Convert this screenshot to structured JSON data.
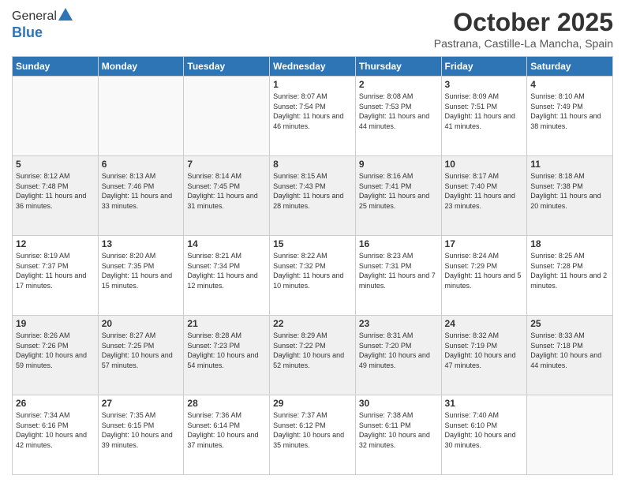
{
  "logo": {
    "general": "General",
    "blue": "Blue"
  },
  "title": "October 2025",
  "location": "Pastrana, Castille-La Mancha, Spain",
  "days_of_week": [
    "Sunday",
    "Monday",
    "Tuesday",
    "Wednesday",
    "Thursday",
    "Friday",
    "Saturday"
  ],
  "weeks": [
    [
      {
        "day": "",
        "sunrise": "",
        "sunset": "",
        "daylight": ""
      },
      {
        "day": "",
        "sunrise": "",
        "sunset": "",
        "daylight": ""
      },
      {
        "day": "",
        "sunrise": "",
        "sunset": "",
        "daylight": ""
      },
      {
        "day": "1",
        "sunrise": "Sunrise: 8:07 AM",
        "sunset": "Sunset: 7:54 PM",
        "daylight": "Daylight: 11 hours and 46 minutes."
      },
      {
        "day": "2",
        "sunrise": "Sunrise: 8:08 AM",
        "sunset": "Sunset: 7:53 PM",
        "daylight": "Daylight: 11 hours and 44 minutes."
      },
      {
        "day": "3",
        "sunrise": "Sunrise: 8:09 AM",
        "sunset": "Sunset: 7:51 PM",
        "daylight": "Daylight: 11 hours and 41 minutes."
      },
      {
        "day": "4",
        "sunrise": "Sunrise: 8:10 AM",
        "sunset": "Sunset: 7:49 PM",
        "daylight": "Daylight: 11 hours and 38 minutes."
      }
    ],
    [
      {
        "day": "5",
        "sunrise": "Sunrise: 8:12 AM",
        "sunset": "Sunset: 7:48 PM",
        "daylight": "Daylight: 11 hours and 36 minutes."
      },
      {
        "day": "6",
        "sunrise": "Sunrise: 8:13 AM",
        "sunset": "Sunset: 7:46 PM",
        "daylight": "Daylight: 11 hours and 33 minutes."
      },
      {
        "day": "7",
        "sunrise": "Sunrise: 8:14 AM",
        "sunset": "Sunset: 7:45 PM",
        "daylight": "Daylight: 11 hours and 31 minutes."
      },
      {
        "day": "8",
        "sunrise": "Sunrise: 8:15 AM",
        "sunset": "Sunset: 7:43 PM",
        "daylight": "Daylight: 11 hours and 28 minutes."
      },
      {
        "day": "9",
        "sunrise": "Sunrise: 8:16 AM",
        "sunset": "Sunset: 7:41 PM",
        "daylight": "Daylight: 11 hours and 25 minutes."
      },
      {
        "day": "10",
        "sunrise": "Sunrise: 8:17 AM",
        "sunset": "Sunset: 7:40 PM",
        "daylight": "Daylight: 11 hours and 23 minutes."
      },
      {
        "day": "11",
        "sunrise": "Sunrise: 8:18 AM",
        "sunset": "Sunset: 7:38 PM",
        "daylight": "Daylight: 11 hours and 20 minutes."
      }
    ],
    [
      {
        "day": "12",
        "sunrise": "Sunrise: 8:19 AM",
        "sunset": "Sunset: 7:37 PM",
        "daylight": "Daylight: 11 hours and 17 minutes."
      },
      {
        "day": "13",
        "sunrise": "Sunrise: 8:20 AM",
        "sunset": "Sunset: 7:35 PM",
        "daylight": "Daylight: 11 hours and 15 minutes."
      },
      {
        "day": "14",
        "sunrise": "Sunrise: 8:21 AM",
        "sunset": "Sunset: 7:34 PM",
        "daylight": "Daylight: 11 hours and 12 minutes."
      },
      {
        "day": "15",
        "sunrise": "Sunrise: 8:22 AM",
        "sunset": "Sunset: 7:32 PM",
        "daylight": "Daylight: 11 hours and 10 minutes."
      },
      {
        "day": "16",
        "sunrise": "Sunrise: 8:23 AM",
        "sunset": "Sunset: 7:31 PM",
        "daylight": "Daylight: 11 hours and 7 minutes."
      },
      {
        "day": "17",
        "sunrise": "Sunrise: 8:24 AM",
        "sunset": "Sunset: 7:29 PM",
        "daylight": "Daylight: 11 hours and 5 minutes."
      },
      {
        "day": "18",
        "sunrise": "Sunrise: 8:25 AM",
        "sunset": "Sunset: 7:28 PM",
        "daylight": "Daylight: 11 hours and 2 minutes."
      }
    ],
    [
      {
        "day": "19",
        "sunrise": "Sunrise: 8:26 AM",
        "sunset": "Sunset: 7:26 PM",
        "daylight": "Daylight: 10 hours and 59 minutes."
      },
      {
        "day": "20",
        "sunrise": "Sunrise: 8:27 AM",
        "sunset": "Sunset: 7:25 PM",
        "daylight": "Daylight: 10 hours and 57 minutes."
      },
      {
        "day": "21",
        "sunrise": "Sunrise: 8:28 AM",
        "sunset": "Sunset: 7:23 PM",
        "daylight": "Daylight: 10 hours and 54 minutes."
      },
      {
        "day": "22",
        "sunrise": "Sunrise: 8:29 AM",
        "sunset": "Sunset: 7:22 PM",
        "daylight": "Daylight: 10 hours and 52 minutes."
      },
      {
        "day": "23",
        "sunrise": "Sunrise: 8:31 AM",
        "sunset": "Sunset: 7:20 PM",
        "daylight": "Daylight: 10 hours and 49 minutes."
      },
      {
        "day": "24",
        "sunrise": "Sunrise: 8:32 AM",
        "sunset": "Sunset: 7:19 PM",
        "daylight": "Daylight: 10 hours and 47 minutes."
      },
      {
        "day": "25",
        "sunrise": "Sunrise: 8:33 AM",
        "sunset": "Sunset: 7:18 PM",
        "daylight": "Daylight: 10 hours and 44 minutes."
      }
    ],
    [
      {
        "day": "26",
        "sunrise": "Sunrise: 7:34 AM",
        "sunset": "Sunset: 6:16 PM",
        "daylight": "Daylight: 10 hours and 42 minutes."
      },
      {
        "day": "27",
        "sunrise": "Sunrise: 7:35 AM",
        "sunset": "Sunset: 6:15 PM",
        "daylight": "Daylight: 10 hours and 39 minutes."
      },
      {
        "day": "28",
        "sunrise": "Sunrise: 7:36 AM",
        "sunset": "Sunset: 6:14 PM",
        "daylight": "Daylight: 10 hours and 37 minutes."
      },
      {
        "day": "29",
        "sunrise": "Sunrise: 7:37 AM",
        "sunset": "Sunset: 6:12 PM",
        "daylight": "Daylight: 10 hours and 35 minutes."
      },
      {
        "day": "30",
        "sunrise": "Sunrise: 7:38 AM",
        "sunset": "Sunset: 6:11 PM",
        "daylight": "Daylight: 10 hours and 32 minutes."
      },
      {
        "day": "31",
        "sunrise": "Sunrise: 7:40 AM",
        "sunset": "Sunset: 6:10 PM",
        "daylight": "Daylight: 10 hours and 30 minutes."
      },
      {
        "day": "",
        "sunrise": "",
        "sunset": "",
        "daylight": ""
      }
    ]
  ]
}
